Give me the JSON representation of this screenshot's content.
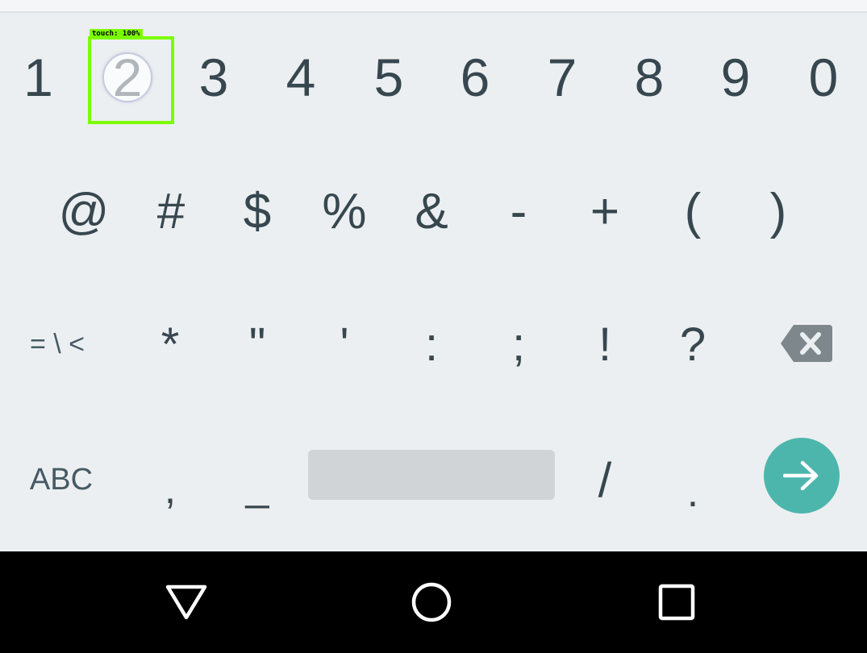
{
  "annotation": {
    "touch_label": "touch: 100%"
  },
  "keyboard": {
    "row1": [
      "1",
      "2",
      "3",
      "4",
      "5",
      "6",
      "7",
      "8",
      "9",
      "0"
    ],
    "row2": [
      "@",
      "#",
      "$",
      "%",
      "&",
      "-",
      "+",
      "(",
      ")"
    ],
    "row3": [
      "= \\ <",
      "*",
      "\"",
      "'",
      ":",
      ";",
      "!",
      "?"
    ],
    "row4": {
      "abc_label": "ABC",
      "comma": ",",
      "underscore": "_",
      "slash": "/",
      "period": "."
    },
    "pressed_key": "2",
    "enter_color": "#4db6ac",
    "backspace_icon": "backspace-icon",
    "enter_icon": "arrow-right-icon"
  },
  "navbar": {
    "back_icon": "back-triangle-icon",
    "home_icon": "home-circle-icon",
    "recents_icon": "recents-square-icon"
  }
}
